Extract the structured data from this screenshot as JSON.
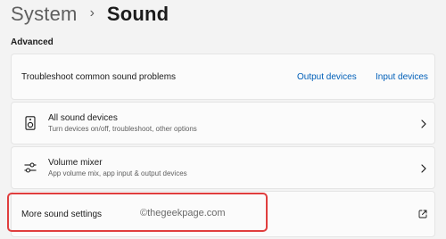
{
  "breadcrumb": {
    "parent": "System",
    "separator": "›",
    "current": "Sound"
  },
  "section": {
    "title": "Advanced"
  },
  "troubleshoot": {
    "label": "Troubleshoot common sound problems",
    "output_link": "Output devices",
    "input_link": "Input devices"
  },
  "rows": [
    {
      "icon": "speaker-device-icon",
      "title": "All sound devices",
      "subtitle": "Turn devices on/off, troubleshoot, other options",
      "action_icon": "chevron-right-icon"
    },
    {
      "icon": "mixer-sliders-icon",
      "title": "Volume mixer",
      "subtitle": "App volume mix, app input & output devices",
      "action_icon": "chevron-right-icon"
    }
  ],
  "more": {
    "label": "More sound settings",
    "action_icon": "external-link-icon"
  },
  "watermark": "©thegeekpage.com",
  "colors": {
    "accent_link": "#005fb8",
    "highlight": "#e03e3e",
    "background": "#f3f3f3",
    "card": "#fbfbfb"
  }
}
